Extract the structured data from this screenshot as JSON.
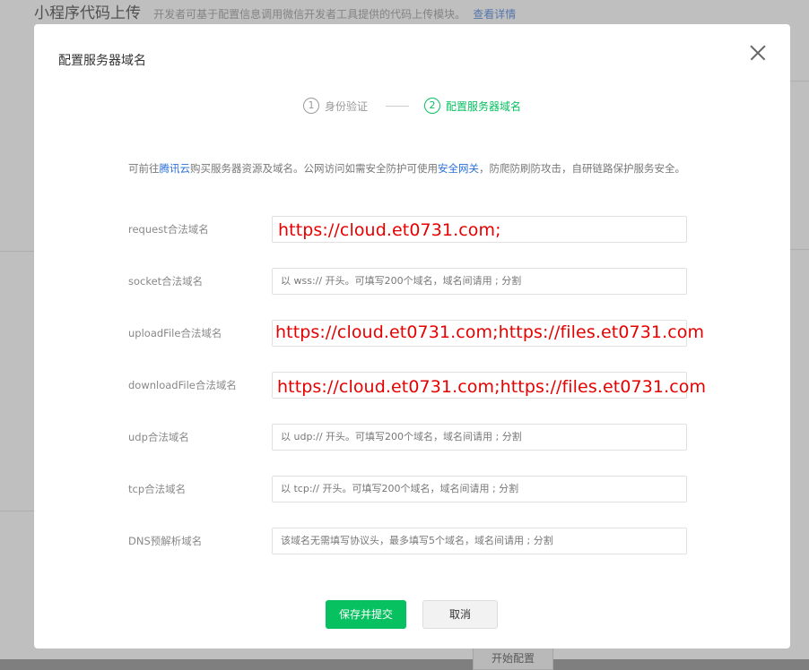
{
  "background": {
    "title": "小程序代码上传",
    "description": "开发者可基于配置信息调用微信开发者工具提供的代码上传模块。",
    "detail_link": "查看详情",
    "bottom_button": "开始配置"
  },
  "dialog": {
    "title": "配置服务器域名",
    "steps": [
      {
        "num": "1",
        "label": "身份验证"
      },
      {
        "num": "2",
        "label": "配置服务器域名"
      }
    ],
    "intro": {
      "part1": "可前往",
      "link1": "腾讯云",
      "part2": "购买服务器资源及域名。公网访问如需安全防护可使用",
      "link2": "安全网关",
      "part3": "，防爬防刷防攻击，自研链路保护服务安全。"
    },
    "fields": {
      "request": {
        "label": "request合法域名",
        "value": "https://cloud.et0731.com;"
      },
      "socket": {
        "label": "socket合法域名",
        "placeholder": "以 wss:// 开头。可填写200个域名，域名间请用 ; 分割"
      },
      "uploadFile": {
        "label": "uploadFile合法域名",
        "value": "https://cloud.et0731.com;https://files.et0731.com"
      },
      "downloadFile": {
        "label": "downloadFile合法域名",
        "value": "https://cloud.et0731.com;https://files.et0731.com"
      },
      "udp": {
        "label": "udp合法域名",
        "placeholder": "以 udp:// 开头。可填写200个域名，域名间请用 ; 分割"
      },
      "tcp": {
        "label": "tcp合法域名",
        "placeholder": "以 tcp:// 开头。可填写200个域名，域名间请用 ; 分割"
      },
      "dns": {
        "label": "DNS预解析域名",
        "placeholder": "该域名无需填写协议头，最多填写5个域名，域名间请用 ; 分割"
      }
    },
    "buttons": {
      "save": "保存并提交",
      "cancel": "取消"
    }
  },
  "colors": {
    "accent": "#07c160",
    "link": "#2a6fd6",
    "annotation": "#e60000"
  }
}
